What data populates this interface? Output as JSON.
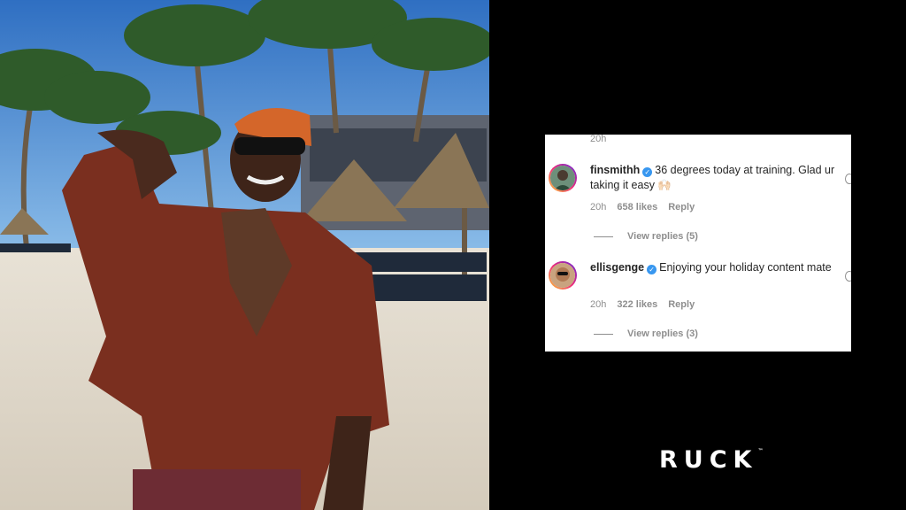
{
  "photo": {
    "alt": ""
  },
  "comments_panel": {
    "top_timestamp": "20h",
    "comments": [
      {
        "username": "finsmithh",
        "verified": true,
        "text": "36 degrees today at training. Glad ur taking it easy 🙌🏻",
        "time": "20h",
        "likes": "658 likes",
        "reply_label": "Reply",
        "view_replies": "View replies (5)"
      },
      {
        "username": "ellisgenge",
        "verified": true,
        "text": "Enjoying your holiday content mate",
        "time": "20h",
        "likes": "322 likes",
        "reply_label": "Reply",
        "view_replies": "View replies (3)"
      }
    ]
  },
  "brand": {
    "logo_text": "RUCK",
    "trademark": "™"
  },
  "colors": {
    "accent_blue": "#3897f0",
    "muted": "#8e8e8e",
    "text": "#262626"
  }
}
